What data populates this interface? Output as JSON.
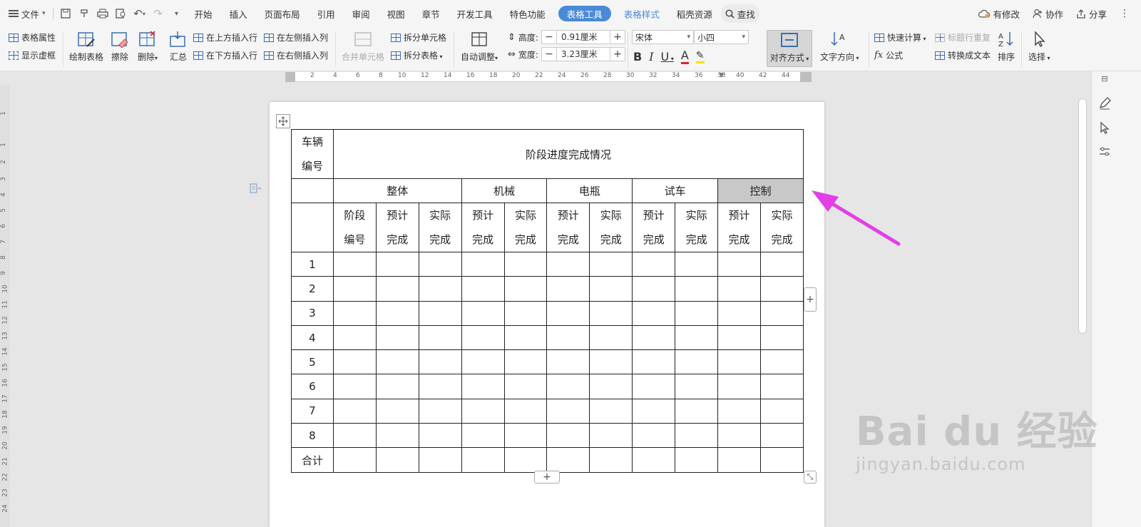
{
  "menubar": {
    "file_label": "文件",
    "tabs": [
      "开始",
      "插入",
      "页面布局",
      "引用",
      "审阅",
      "视图",
      "章节",
      "开发工具",
      "特色功能"
    ],
    "active_tool_tab": "表格工具",
    "style_tab": "表格样式",
    "resource_tab": "稻壳资源",
    "search_label": "查找",
    "right": {
      "modified": "有修改",
      "collab": "协作",
      "share": "分享"
    }
  },
  "ribbon": {
    "table_props": "表格属性",
    "show_gridlines": "显示虚框",
    "draw_table": "绘制表格",
    "erase": "擦除",
    "delete": "删除",
    "summary": "汇总",
    "insert_above": "在上方插入行",
    "insert_below": "在下方插入行",
    "insert_left": "在左侧插入列",
    "insert_right": "在右侧插入列",
    "merge_cells": "合并单元格",
    "split_cells": "拆分单元格",
    "split_table": "拆分表格",
    "auto_fit": "自动调整",
    "height_label": "高度:",
    "height_value": "0.91厘米",
    "width_label": "宽度:",
    "width_value": "3.23厘米",
    "font_name": "宋体",
    "font_size": "小四",
    "align": "对齐方式",
    "text_dir": "文字方向",
    "quick_calc": "快速计算",
    "formula": "公式",
    "repeat_header": "标题行重复",
    "to_text": "转换成文本",
    "sort": "排序",
    "select": "选择"
  },
  "ruler": {
    "h_ticks": [
      "2",
      "4",
      "6",
      "8",
      "10",
      "12",
      "14",
      "16",
      "18",
      "20",
      "22",
      "24",
      "26",
      "28",
      "30",
      "32",
      "34",
      "36",
      "38",
      "40",
      "42",
      "44"
    ],
    "v_ticks": [
      "1",
      "1",
      "2",
      "3",
      "4",
      "5",
      "6",
      "7",
      "8",
      "9",
      "10",
      "11",
      "12",
      "13",
      "14",
      "15",
      "16",
      "17",
      "18",
      "19",
      "20",
      "21",
      "22",
      "23",
      "24"
    ]
  },
  "table": {
    "vehicle_no_line1": "车辆",
    "vehicle_no_line2": "编号",
    "title": "阶段进度完成情况",
    "groups": [
      "整体",
      "机械",
      "电瓶",
      "试车",
      "控制"
    ],
    "stage_no_line1": "阶段",
    "stage_no_line2": "编号",
    "planned_line1": "预计",
    "planned_line2": "完成",
    "actual_line1": "实际",
    "actual_line2": "完成",
    "rows": [
      "1",
      "2",
      "3",
      "4",
      "5",
      "6",
      "7",
      "8",
      "合计"
    ]
  },
  "controls": {
    "plus": "+"
  },
  "watermark": {
    "brand": "Bai du 经验",
    "url": "jingyan.baidu.com"
  },
  "colors": {
    "accent": "#4a8ad7",
    "annotation": "#e23fe6",
    "highlight_cell": "#c8c8c8"
  }
}
